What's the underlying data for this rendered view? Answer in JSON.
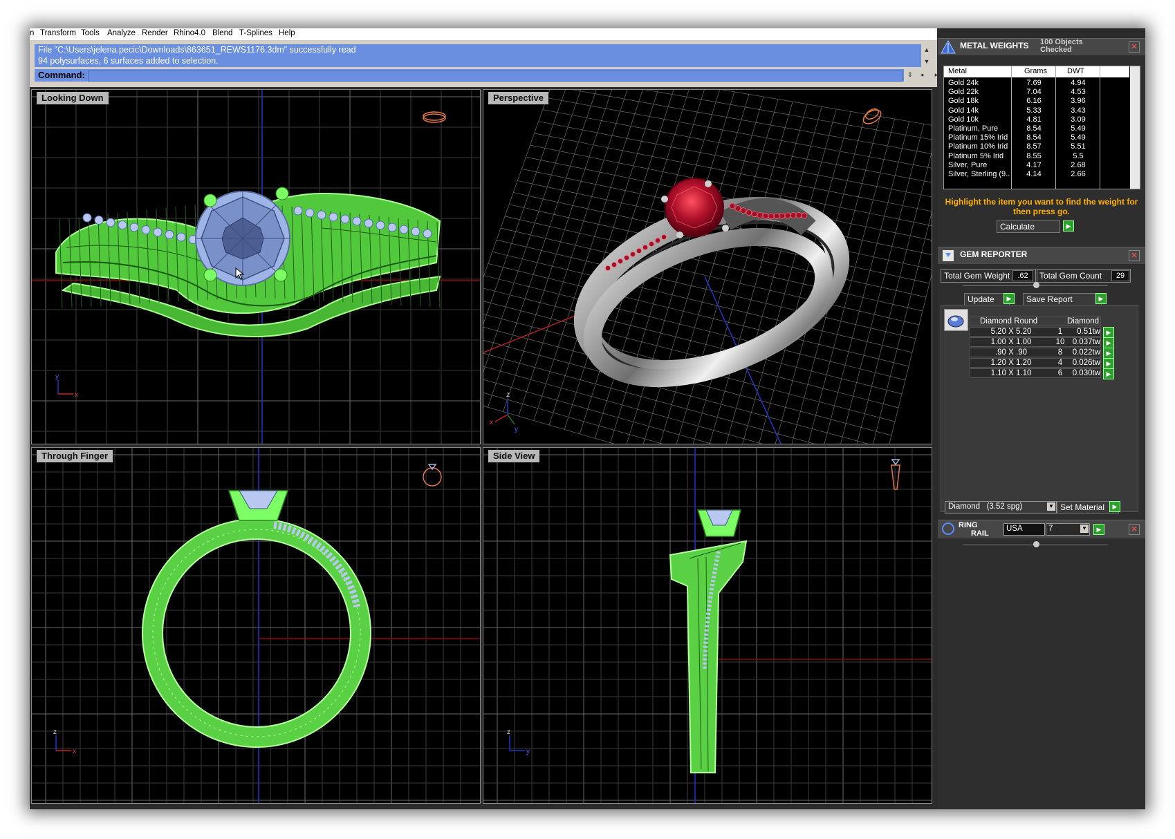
{
  "menu": [
    "n",
    "Transform",
    "Tools",
    "Analyze",
    "Render",
    "Rhino4.0",
    "Blend",
    "T-Splines",
    "Help"
  ],
  "command": {
    "history": [
      "File \"C:\\Users\\jelena.pecic\\Downloads\\863651_REWS1176.3dm\" successfully read",
      "94 polysurfaces, 6 surfaces added to selection."
    ],
    "label": "Command:",
    "value": ""
  },
  "viewports": {
    "top_left": "Looking Down",
    "top_right": "Perspective",
    "bottom_left": "Through Finger",
    "bottom_right": "Side View"
  },
  "axis_labels": {
    "x": "x",
    "y": "y",
    "z": "z"
  },
  "metal_weights": {
    "title": "METAL WEIGHTS",
    "status": "100 Objects Checked",
    "columns": [
      "Metal",
      "Grams",
      "DWT"
    ],
    "rows": [
      [
        "Gold 24k",
        "7.69",
        "4.94"
      ],
      [
        "Gold 22k",
        "7.04",
        "4.53"
      ],
      [
        "Gold 18k",
        "6.16",
        "3.96"
      ],
      [
        "Gold 14k",
        "5.33",
        "3.43"
      ],
      [
        "Gold 10k",
        "4.81",
        "3.09"
      ],
      [
        "Platinum, Pure",
        "8.54",
        "5.49"
      ],
      [
        "Platinum 15% Irid",
        "8.54",
        "5.49"
      ],
      [
        "Platinum 10% Irid",
        "8.57",
        "5.51"
      ],
      [
        "Platinum 5% Irid",
        "8.55",
        "5.5"
      ],
      [
        "Silver, Pure",
        "4.17",
        "2.68"
      ],
      [
        "Silver, Sterling (9...",
        "4.14",
        "2.66"
      ]
    ],
    "hint": "Highlight the item you want to find the weight for then press go.",
    "calculate_label": "Calculate"
  },
  "gem_reporter": {
    "title": "GEM REPORTER",
    "total_weight_label": "Total Gem Weight",
    "total_weight": ".62",
    "total_count_label": "Total Gem Count",
    "total_count": "29",
    "update_label": "Update",
    "save_label": "Save Report",
    "table_headers": [
      "Diamond Round",
      "Diamond"
    ],
    "rows": [
      [
        "5.20 X 5.20",
        "1",
        "0.51tw"
      ],
      [
        "1.00 X 1.00",
        "10",
        "0.037tw"
      ],
      [
        ".90 X .90",
        "8",
        "0.022tw"
      ],
      [
        "1.20 X 1.20",
        "4",
        "0.026tw"
      ],
      [
        "1.10 X 1.10",
        "6",
        "0.030tw"
      ]
    ],
    "material_select": "Diamond   (3.52 spg)",
    "set_material_label": "Set Material"
  },
  "ring_rail": {
    "title_line1": "RING",
    "title_line2": "RAIL",
    "standard": "USA",
    "size": "7"
  },
  "colors": {
    "wireframe": "#7dff66",
    "gem": "#b9c8f0",
    "ruby": "#b0102a",
    "command_bg": "#6a8fe0",
    "highlight_text": "#ffb000"
  }
}
